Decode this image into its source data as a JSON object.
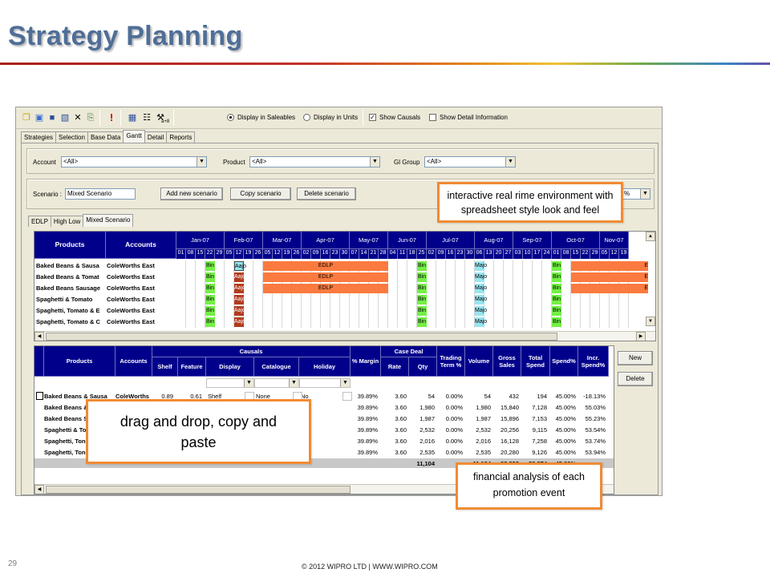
{
  "slide": {
    "title": "Strategy Planning",
    "number": "29",
    "copyright": "© 2012 WIPRO LTD | WWW.WIPRO.COM"
  },
  "toolbar": {
    "display_saleables": "Display in Saleables",
    "display_units": "Display in Units",
    "show_causals": "Show Causals",
    "show_detail": "Show Detail Information",
    "icon_label": "a+8"
  },
  "tabs": [
    "Strategies",
    "Selection",
    "Base Data",
    "Gantt",
    "Detail",
    "Reports"
  ],
  "filters": {
    "account_label": "Account",
    "account_value": "<All>",
    "product_label": "Product",
    "product_value": "<All>",
    "gl_group_label": "Gl Group",
    "gl_group_value": "<All>"
  },
  "scenario": {
    "label": "Scenario :",
    "value": "Mixed Scenario",
    "add_button": "Add new scenario",
    "copy_button": "Copy scenario",
    "delete_button": "Delete scenario",
    "right_combo_value": "%"
  },
  "subtabs": [
    "EDLP",
    "High Low",
    "Mixed Scenario"
  ],
  "gantt": {
    "col_products": "Products",
    "col_accounts": "Accounts",
    "months": [
      "Jan-07",
      "Feb-07",
      "Mar-07",
      "Apr-07",
      "May-07",
      "Jun-07",
      "Jul-07",
      "Aug-07",
      "Sep-07",
      "Oct-07",
      "Nov-07"
    ],
    "days": [
      "01",
      "08",
      "15",
      "22",
      "29",
      "05",
      "12",
      "19",
      "26",
      "05",
      "12",
      "19",
      "26",
      "02",
      "09",
      "16",
      "23",
      "30",
      "07",
      "14",
      "21",
      "28",
      "04",
      "11",
      "18",
      "25",
      "02",
      "09",
      "16",
      "23",
      "30",
      "06",
      "13",
      "20",
      "27",
      "03",
      "10",
      "17",
      "24",
      "01",
      "08",
      "15",
      "22",
      "29",
      "05",
      "12",
      "19"
    ],
    "rows": [
      {
        "product": "Baked Beans & Sausa",
        "account": "ColeWorths East"
      },
      {
        "product": "Baked Beans & Tomat",
        "account": "ColeWorths East"
      },
      {
        "product": "Baked Beans Sausage",
        "account": "ColeWorths East"
      },
      {
        "product": "Spaghetti & Tomato",
        "account": "ColeWorths East"
      },
      {
        "product": "Spaghetti, Tomato & E",
        "account": "ColeWorths East"
      },
      {
        "product": "Spaghetti, Tomato & C",
        "account": "ColeWorths East"
      }
    ],
    "bin_label": "Bin",
    "ajo_label": "Aajo",
    "majo_label": "Majo",
    "edlp_label": "EDLP",
    "e_label": "E"
  },
  "deal": {
    "headers": {
      "products": "Products",
      "accounts": "Accounts",
      "causals": "Causals",
      "shelf": "Shelf",
      "feature": "Feature",
      "display": "Display",
      "catalogue": "Catalogue",
      "holiday": "Holiday",
      "margin": "% Margin",
      "case_deal": "Case Deal",
      "rate": "Rate",
      "qty": "Qty",
      "trading_term": "Trading Term %",
      "volume": "Volume",
      "gross_sales": "Gross Sales",
      "total_spend": "Total Spend",
      "spend_pct": "Spend%",
      "incr_spend": "Incr. Spend%"
    },
    "rows": [
      {
        "product": "Baked Beans & Sausa",
        "account": "ColeWorths",
        "shelf": "0.89",
        "feature": "0.61",
        "display": "Shelf",
        "catalogue": "None",
        "holiday": "No",
        "margin": "39.89%",
        "rate": "3.60",
        "qty": "54",
        "term": "0.00%",
        "volume": "54",
        "gross": "432",
        "spend": "194",
        "spend_pct": "45.00%",
        "incr": "-18.13%"
      },
      {
        "product": "Baked Beans &",
        "account": "",
        "shelf": "",
        "feature": "",
        "display": "",
        "catalogue": "",
        "holiday": "",
        "margin": "39.89%",
        "rate": "3.60",
        "qty": "1,980",
        "term": "0.00%",
        "volume": "1,980",
        "gross": "15,840",
        "spend": "7,128",
        "spend_pct": "45.00%",
        "incr": "55.03%"
      },
      {
        "product": "Baked Beans S",
        "account": "",
        "shelf": "",
        "feature": "",
        "display": "",
        "catalogue": "",
        "holiday": "",
        "margin": "39.89%",
        "rate": "3.60",
        "qty": "1,987",
        "term": "0.00%",
        "volume": "1,987",
        "gross": "15,896",
        "spend": "7,153",
        "spend_pct": "45.00%",
        "incr": "55.23%"
      },
      {
        "product": "Spaghetti & To",
        "account": "",
        "shelf": "",
        "feature": "",
        "display": "",
        "catalogue": "",
        "holiday": "",
        "margin": "39.89%",
        "rate": "3.60",
        "qty": "2,532",
        "term": "0.00%",
        "volume": "2,532",
        "gross": "20,256",
        "spend": "9,115",
        "spend_pct": "45.00%",
        "incr": "53.54%"
      },
      {
        "product": "Spaghetti, Ton",
        "account": "",
        "shelf": "",
        "feature": "",
        "display": "",
        "catalogue": "",
        "holiday": "",
        "margin": "39.89%",
        "rate": "3.60",
        "qty": "2,016",
        "term": "0.00%",
        "volume": "2,016",
        "gross": "16,128",
        "spend": "7,258",
        "spend_pct": "45.00%",
        "incr": "53.74%"
      },
      {
        "product": "Spaghetti, Ton",
        "account": "",
        "shelf": "",
        "feature": "",
        "display": "",
        "catalogue": "",
        "holiday": "",
        "margin": "39.89%",
        "rate": "3.60",
        "qty": "2,535",
        "term": "0.00%",
        "volume": "2,535",
        "gross": "20,280",
        "spend": "9,126",
        "spend_pct": "45.00%",
        "incr": "53.94%"
      }
    ],
    "totals": {
      "qty": "11,104",
      "volume": "11,104",
      "gross": "88,832",
      "spend": "39,974",
      "spend_pct": "45.00%"
    },
    "new_button": "New",
    "delete_button": "Delete"
  },
  "callouts": {
    "interactive": "interactive real rime environment with spreadsheet  style look and feel",
    "drag": "drag and drop, copy and paste",
    "financial": "financial analysis of each promotion event"
  },
  "colors": {
    "title": "#4f6e97",
    "header_blue": "#00008b",
    "promo_orange": "#fb7a3f",
    "bin_green": "#73f046",
    "majo_cyan": "#96e6f2",
    "callout_border": "#f08b33"
  }
}
